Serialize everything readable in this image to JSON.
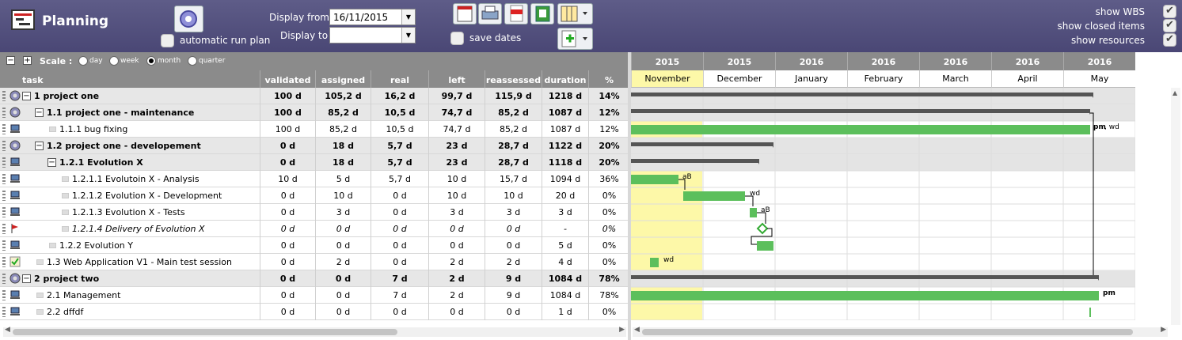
{
  "header": {
    "title": "Planning",
    "auto_run_label": "automatic run plan",
    "display_from_label": "Display from",
    "display_from_value": "16/11/2015",
    "display_to_label": "Display to",
    "display_to_value": "",
    "save_dates_label": "save dates",
    "show_wbs": "show WBS",
    "show_closed": "show closed items",
    "show_resources": "show resources"
  },
  "scale": {
    "label": "Scale :",
    "options": [
      "day",
      "week",
      "month",
      "quarter"
    ],
    "selected": "month"
  },
  "columns": [
    "task",
    "validated",
    "assigned",
    "real",
    "left",
    "reassessed",
    "duration",
    "%"
  ],
  "rows": [
    {
      "icon": "gear",
      "level": 0,
      "group": true,
      "task": "1 project one",
      "v": "100 d",
      "a": "105,2 d",
      "r": "16,2 d",
      "l": "99,7 d",
      "re": "115,9 d",
      "d": "1218 d",
      "p": "14%"
    },
    {
      "icon": "gear",
      "level": 1,
      "group": true,
      "task": "1.1 project one - maintenance",
      "v": "100 d",
      "a": "85,2 d",
      "r": "10,5 d",
      "l": "74,7 d",
      "re": "85,2 d",
      "d": "1087 d",
      "p": "12%"
    },
    {
      "icon": "pc",
      "level": 2,
      "group": false,
      "task": "1.1.1 bug fixing",
      "v": "100 d",
      "a": "85,2 d",
      "r": "10,5 d",
      "l": "74,7 d",
      "re": "85,2 d",
      "d": "1087 d",
      "p": "12%"
    },
    {
      "icon": "gear",
      "level": 1,
      "group": true,
      "task": "1.2 project one - developement",
      "v": "0 d",
      "a": "18 d",
      "r": "5,7 d",
      "l": "23 d",
      "re": "28,7 d",
      "d": "1122 d",
      "p": "20%"
    },
    {
      "icon": "pc",
      "level": 2,
      "group": true,
      "task": "1.2.1 Evolution X",
      "v": "0 d",
      "a": "18 d",
      "r": "5,7 d",
      "l": "23 d",
      "re": "28,7 d",
      "d": "1118 d",
      "p": "20%"
    },
    {
      "icon": "pc",
      "level": 3,
      "group": false,
      "task": "1.2.1.1 Evolutoin X - Analysis",
      "v": "10 d",
      "a": "5 d",
      "r": "5,7 d",
      "l": "10 d",
      "re": "15,7 d",
      "d": "1094 d",
      "p": "36%"
    },
    {
      "icon": "pc",
      "level": 3,
      "group": false,
      "task": "1.2.1.2 Evolution X - Development",
      "v": "0 d",
      "a": "10 d",
      "r": "0 d",
      "l": "10 d",
      "re": "10 d",
      "d": "20 d",
      "p": "0%"
    },
    {
      "icon": "pc",
      "level": 3,
      "group": false,
      "task": "1.2.1.3 Evolution X - Tests",
      "v": "0 d",
      "a": "3 d",
      "r": "0 d",
      "l": "3 d",
      "re": "3 d",
      "d": "3 d",
      "p": "0%"
    },
    {
      "icon": "flag",
      "level": 3,
      "group": false,
      "italic": true,
      "task": "1.2.1.4 Delivery of Evolution X",
      "v": "0 d",
      "a": "0 d",
      "r": "0 d",
      "l": "0 d",
      "re": "0 d",
      "d": "-",
      "p": "0%"
    },
    {
      "icon": "pc",
      "level": 2,
      "group": false,
      "task": "1.2.2 Evolution Y",
      "v": "0 d",
      "a": "0 d",
      "r": "0 d",
      "l": "0 d",
      "re": "0 d",
      "d": "5 d",
      "p": "0%"
    },
    {
      "icon": "test",
      "level": 1,
      "group": false,
      "task": "1.3 Web Application V1 - Main test session",
      "v": "0 d",
      "a": "2 d",
      "r": "0 d",
      "l": "2 d",
      "re": "2 d",
      "d": "4 d",
      "p": "0%"
    },
    {
      "icon": "gear",
      "level": 0,
      "group": true,
      "task": "2 project two",
      "v": "0 d",
      "a": "0 d",
      "r": "7 d",
      "l": "2 d",
      "re": "9 d",
      "d": "1084 d",
      "p": "78%"
    },
    {
      "icon": "pc",
      "level": 1,
      "group": false,
      "task": "2.1 Management",
      "v": "0 d",
      "a": "0 d",
      "r": "7 d",
      "l": "2 d",
      "re": "9 d",
      "d": "1084 d",
      "p": "78%"
    },
    {
      "icon": "pc",
      "level": 1,
      "group": false,
      "task": "2.2 dffdf",
      "v": "0 d",
      "a": "0 d",
      "r": "0 d",
      "l": "0 d",
      "re": "0 d",
      "d": "1 d",
      "p": "0%"
    }
  ],
  "timeline": {
    "years": [
      "2015",
      "2015",
      "2016",
      "2016",
      "2016",
      "2016",
      "2016"
    ],
    "months": [
      "November",
      "December",
      "January",
      "February",
      "March",
      "April",
      "May"
    ]
  },
  "gantt_labels": {
    "bug_fixing": "pm",
    "bug_fixing_extra": ", wd",
    "analysis": "aB",
    "development": "wd",
    "tests": "aB",
    "test_session": "wd",
    "management": "pm"
  },
  "colors": {
    "header": "#4f4c7a",
    "bar": "#5cbf5c",
    "summary": "#555555",
    "today": "#fdf8a8"
  }
}
